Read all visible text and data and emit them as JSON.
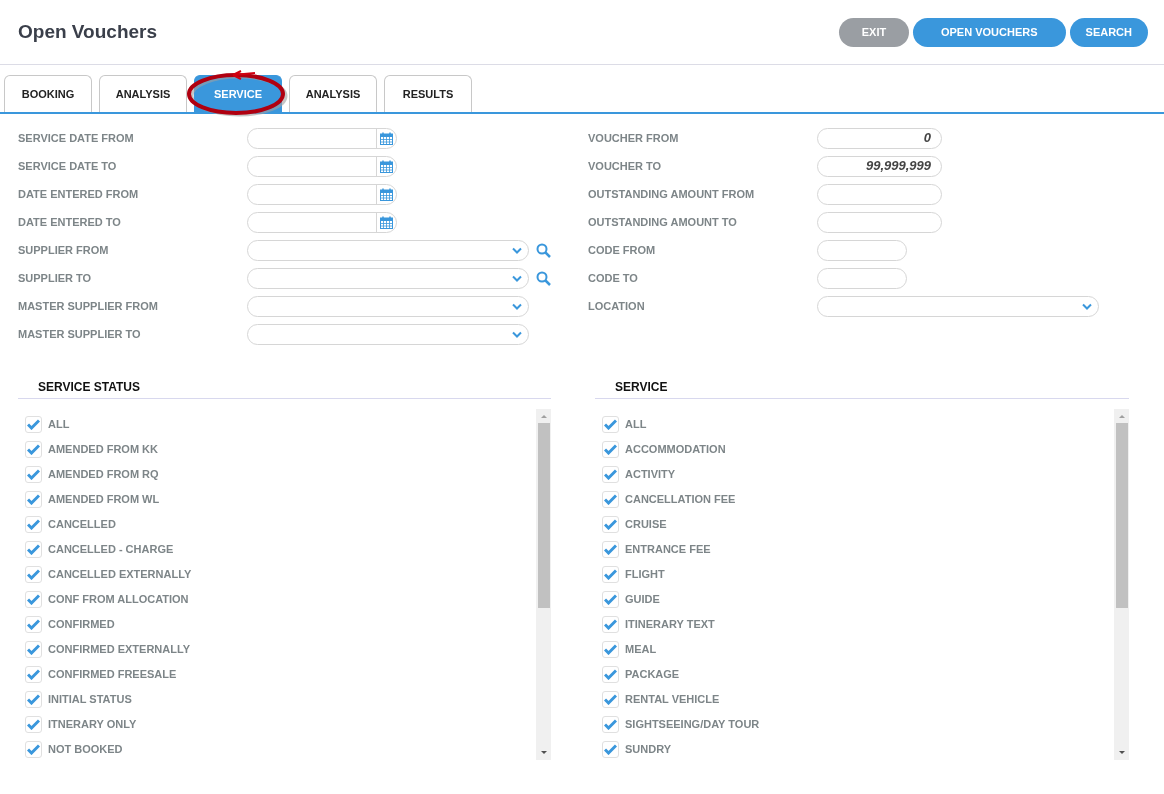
{
  "header": {
    "title": "Open Vouchers",
    "buttons": [
      {
        "label": "EXIT",
        "kind": "secondary"
      },
      {
        "label": "OPEN VOUCHERS",
        "kind": "primary"
      },
      {
        "label": "SEARCH",
        "kind": "primary"
      }
    ]
  },
  "tabs": [
    {
      "label": "BOOKING",
      "selected": false,
      "circled": false
    },
    {
      "label": "ANALYSIS",
      "selected": false,
      "circled": false
    },
    {
      "label": "SERVICE",
      "selected": true,
      "circled": true
    },
    {
      "label": "ANALYSIS",
      "selected": false,
      "circled": false
    },
    {
      "label": "RESULTS",
      "selected": false,
      "circled": false
    }
  ],
  "left_fields": [
    {
      "label": "SERVICE DATE FROM",
      "kind": "date"
    },
    {
      "label": "SERVICE DATE TO",
      "kind": "date"
    },
    {
      "label": "DATE ENTERED FROM",
      "kind": "date"
    },
    {
      "label": "DATE ENTERED TO",
      "kind": "date"
    },
    {
      "label": "SUPPLIER FROM",
      "kind": "lookup"
    },
    {
      "label": "SUPPLIER TO",
      "kind": "lookup"
    },
    {
      "label": "MASTER SUPPLIER FROM",
      "kind": "select"
    },
    {
      "label": "MASTER SUPPLIER TO",
      "kind": "select"
    }
  ],
  "right_fields": [
    {
      "label": "VOUCHER FROM",
      "kind": "number",
      "value": "0"
    },
    {
      "label": "VOUCHER TO",
      "kind": "number",
      "value": "99,999,999"
    },
    {
      "label": "OUTSTANDING AMOUNT FROM",
      "kind": "number"
    },
    {
      "label": "OUTSTANDING AMOUNT TO",
      "kind": "number"
    },
    {
      "label": "CODE FROM",
      "kind": "code"
    },
    {
      "label": "CODE TO",
      "kind": "code"
    },
    {
      "label": "LOCATION",
      "kind": "select"
    }
  ],
  "service_status": {
    "title": "SERVICE STATUS",
    "items": [
      {
        "label": "ALL",
        "checked": true
      },
      {
        "label": "AMENDED FROM KK",
        "checked": true
      },
      {
        "label": "AMENDED FROM RQ",
        "checked": true
      },
      {
        "label": "AMENDED FROM WL",
        "checked": true
      },
      {
        "label": "CANCELLED",
        "checked": true
      },
      {
        "label": "CANCELLED - CHARGE",
        "checked": true
      },
      {
        "label": "CANCELLED EXTERNALLY",
        "checked": true
      },
      {
        "label": "CONF FROM ALLOCATION",
        "checked": true
      },
      {
        "label": "CONFIRMED",
        "checked": true
      },
      {
        "label": "CONFIRMED EXTERNALLY",
        "checked": true
      },
      {
        "label": "CONFIRMED FREESALE",
        "checked": true
      },
      {
        "label": "INITIAL STATUS",
        "checked": true
      },
      {
        "label": "ITNERARY ONLY",
        "checked": true
      },
      {
        "label": "NOT BOOKED",
        "checked": true
      }
    ]
  },
  "service": {
    "title": "SERVICE",
    "items": [
      {
        "label": "ALL",
        "checked": true
      },
      {
        "label": "ACCOMMODATION",
        "checked": true
      },
      {
        "label": "ACTIVITY",
        "checked": true
      },
      {
        "label": "CANCELLATION FEE",
        "checked": true
      },
      {
        "label": "CRUISE",
        "checked": true
      },
      {
        "label": "ENTRANCE FEE",
        "checked": true
      },
      {
        "label": "FLIGHT",
        "checked": true
      },
      {
        "label": "GUIDE",
        "checked": true
      },
      {
        "label": "ITINERARY TEXT",
        "checked": true
      },
      {
        "label": "MEAL",
        "checked": true
      },
      {
        "label": "PACKAGE",
        "checked": true
      },
      {
        "label": "RENTAL VEHICLE",
        "checked": true
      },
      {
        "label": "SIGHTSEEING/DAY TOUR",
        "checked": true
      },
      {
        "label": "SUNDRY",
        "checked": true
      }
    ]
  }
}
